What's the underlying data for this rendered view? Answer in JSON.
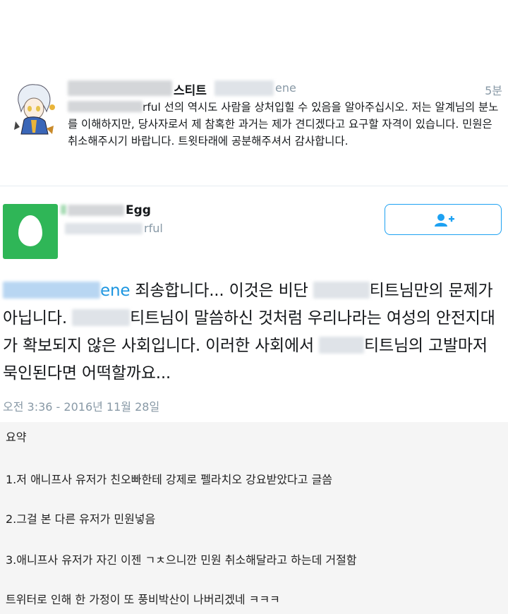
{
  "reply": {
    "name_suffix": "스티트",
    "handle_suffix": "ene",
    "time": "5분",
    "text_fragment": "rful",
    "text_rest": " 선의 역시도 사람을 상처입힐 수 있음을 알아주십시오. 저는 알계님의 분노를 이해하지만, 당사자로서 제 참혹한 과거는 제가 견디겠다고 요구할 자격이 있습니다. 민원은 취소해주시기 바랍니다. 트윗타래에 공분해주셔서 감사합니다."
  },
  "tweet": {
    "name_suffix": "Egg",
    "handle_suffix": "rful",
    "mention_suffix": "ene",
    "text_1": " 죄송합니다... 이것은 비단 ",
    "text_2": "티트님만의 문제가 아닙니다. ",
    "text_3": "티트님이 말씀하신 것처럼 우리나라는 여성의 안전지대가 확보되지 않은 사회입니다. 이러한 사회에서 ",
    "text_4": "티트님의 고발마저 묵인된다면 어떡할까요...",
    "timestamp": "오전 3:36 - 2016년 11월 28일",
    "follow_icon": "add-user-icon"
  },
  "summary": {
    "title": "요약",
    "line1": "1.저 애니프사 유저가 친오빠한테 강제로 펠라치오 강요받았다고 글씀",
    "line2": "2.그걸 본 다른 유저가 민원넣음",
    "line3": "3.애니프사 유저가 자긴 이젠 ㄱㅊ으니깐 민원 취소해달라고 하는데 거절함",
    "line4": "트위터로 인해 한 가정이 또 풍비박산이 나버리겠네 ㅋㅋㅋ"
  },
  "colors": {
    "link": "#1b95e0",
    "muted": "#8899a6",
    "egg_green": "#2fb657",
    "follow_border": "#1da1f2"
  }
}
